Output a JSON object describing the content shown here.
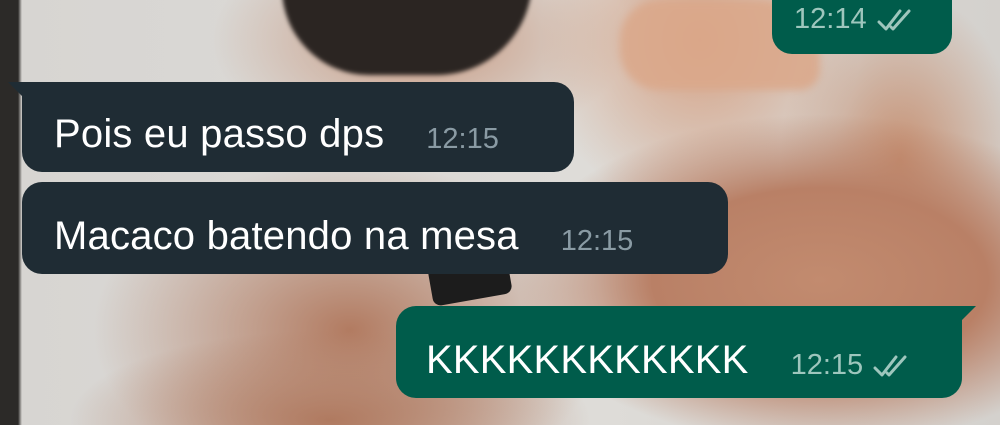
{
  "chat": {
    "messages": [
      {
        "direction": "outgoing",
        "text": "",
        "time": "12:14",
        "status": "read",
        "status_icon": "double-check-icon"
      },
      {
        "direction": "incoming",
        "text": "Pois eu passo dps",
        "time": "12:15"
      },
      {
        "direction": "incoming",
        "text": "Macaco batendo na mesa",
        "time": "12:15"
      },
      {
        "direction": "outgoing",
        "text": "KKKKKKKKKKKK",
        "time": "12:15",
        "status": "read",
        "status_icon": "double-check-icon"
      }
    ]
  },
  "colors": {
    "incoming_bubble": "#1f2c34",
    "outgoing_bubble": "#005c4b",
    "message_text": "#ffffff",
    "timestamp": "#8a9ba4"
  }
}
